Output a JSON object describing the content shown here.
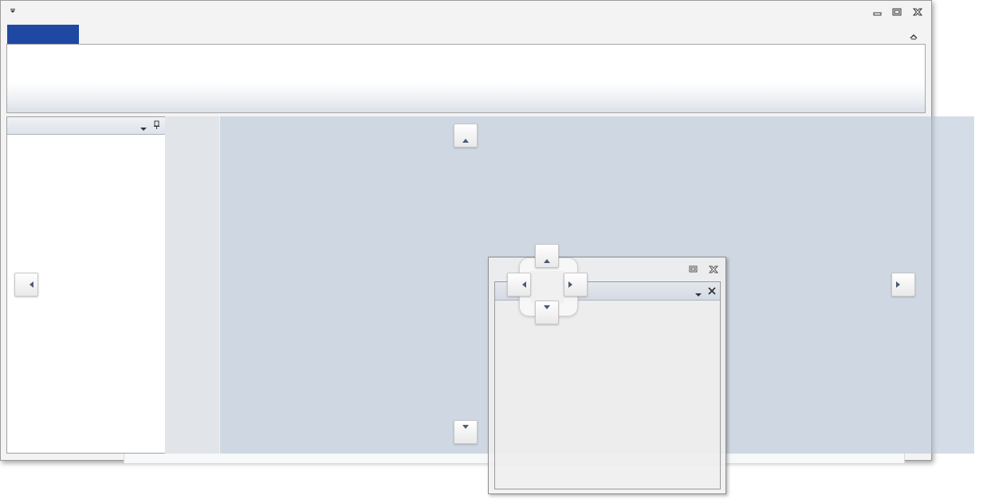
{
  "window": {
    "title": "",
    "quick_access_icon": "chevron-down-icon",
    "controls": {
      "minimize_icon": "minimize-icon",
      "restore_icon": "restore-icon",
      "close_icon": "close-icon"
    },
    "ribbon_collapse_icon": "chevron-up-icon",
    "app_button_color": "#1f48a3"
  },
  "left_panel": {
    "menu_icon": "dropdown-arrow-icon",
    "pin_icon": "pin-icon"
  },
  "floating_panel": {
    "restore_icon": "restore-icon",
    "close_icon": "close-icon",
    "inner_menu_icon": "dropdown-arrow-icon",
    "inner_close_icon": "close-icon"
  },
  "docking_guides": {
    "top": "dock-top-icon",
    "bottom": "dock-bottom-icon",
    "left": "dock-left-icon",
    "right": "dock-right-icon",
    "compass": [
      "dock-up-icon",
      "dock-left-icon",
      "dock-right-icon",
      "dock-down-icon"
    ]
  },
  "colors": {
    "overlay": "#b0c1d4",
    "panel_header": "#dfe4eb"
  }
}
